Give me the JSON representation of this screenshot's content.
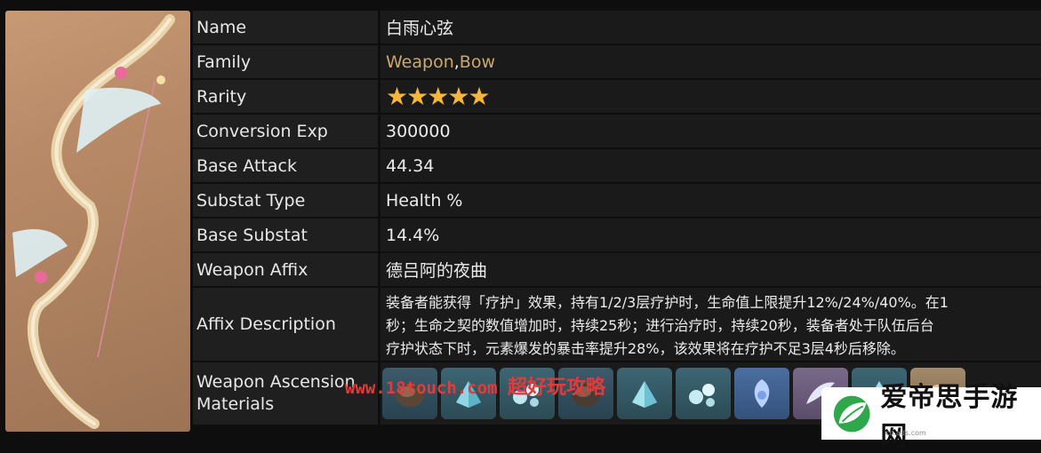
{
  "rows": [
    {
      "label": "Name",
      "value": "白雨心弦"
    },
    {
      "label": "Family",
      "value_parts": [
        "Weapon",
        ", ",
        "Bow"
      ]
    },
    {
      "label": "Rarity",
      "stars": 5
    },
    {
      "label": "Conversion Exp",
      "value": "300000"
    },
    {
      "label": "Base Attack",
      "value": "44.34"
    },
    {
      "label": "Substat Type",
      "value": "Health %"
    },
    {
      "label": "Base Substat",
      "value": "14.4%"
    },
    {
      "label": "Weapon Affix",
      "value": "德吕阿的夜曲"
    },
    {
      "label": "Affix Description",
      "lines": [
        "装备者能获得「疗护」效果，持有1/2/3层疗护时，生命值上限提升12%/24%/40%。在1",
        "秒；生命之契的数值增加时，持续25秒；进行治疗时，持续20秒，装备者处于队伍后台",
        "疗护状态下时，元素爆发的暴击率提升28%，该效果将在疗护不足3层4秒后移除。"
      ]
    },
    {
      "label": "Weapon Ascension Materials",
      "label_lines": [
        "Weapon Ascension",
        "Materials"
      ]
    }
  ],
  "materials": [
    {
      "icon": "shell-icon"
    },
    {
      "icon": "crystal-icon"
    },
    {
      "icon": "bubbles-icon"
    },
    {
      "icon": "shell-icon"
    },
    {
      "icon": "crystal-icon"
    },
    {
      "icon": "bubbles-icon"
    },
    {
      "icon": "gem-icon"
    },
    {
      "icon": "wing-icon"
    },
    {
      "icon": "crystal-icon"
    },
    {
      "icon": "material-icon"
    }
  ],
  "watermark": {
    "url": "www.18touch.com",
    "text": "超好玩攻略"
  },
  "logo": {
    "text": "爱帝思手游网",
    "sub": "cn.ads.com"
  },
  "colors": {
    "link": "#c9a96e",
    "star": "#f4b63b",
    "watermark": "#e23b3b"
  }
}
